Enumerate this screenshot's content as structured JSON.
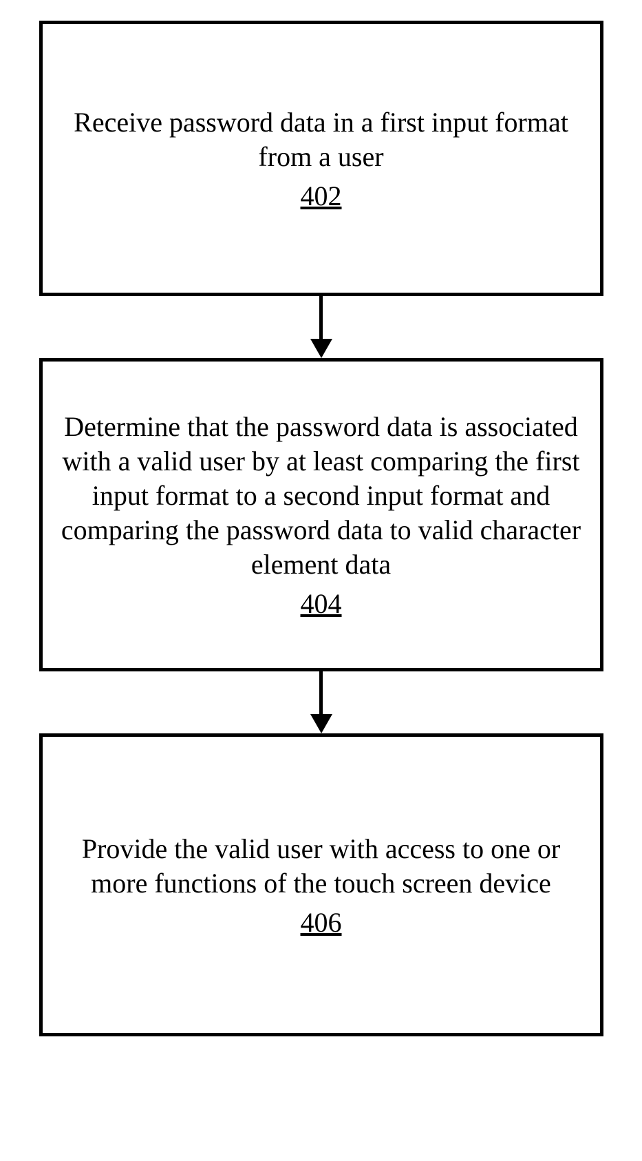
{
  "flow": {
    "steps": [
      {
        "text": "Receive password data in a first input format from a user",
        "ref": "402"
      },
      {
        "text": "Determine that the password data is associated with a valid user by at least comparing the first input format to a second input format and comparing the password data to valid character element data",
        "ref": "404"
      },
      {
        "text": "Provide the valid user with access to one or more functions of the touch screen device",
        "ref": "406"
      }
    ]
  }
}
